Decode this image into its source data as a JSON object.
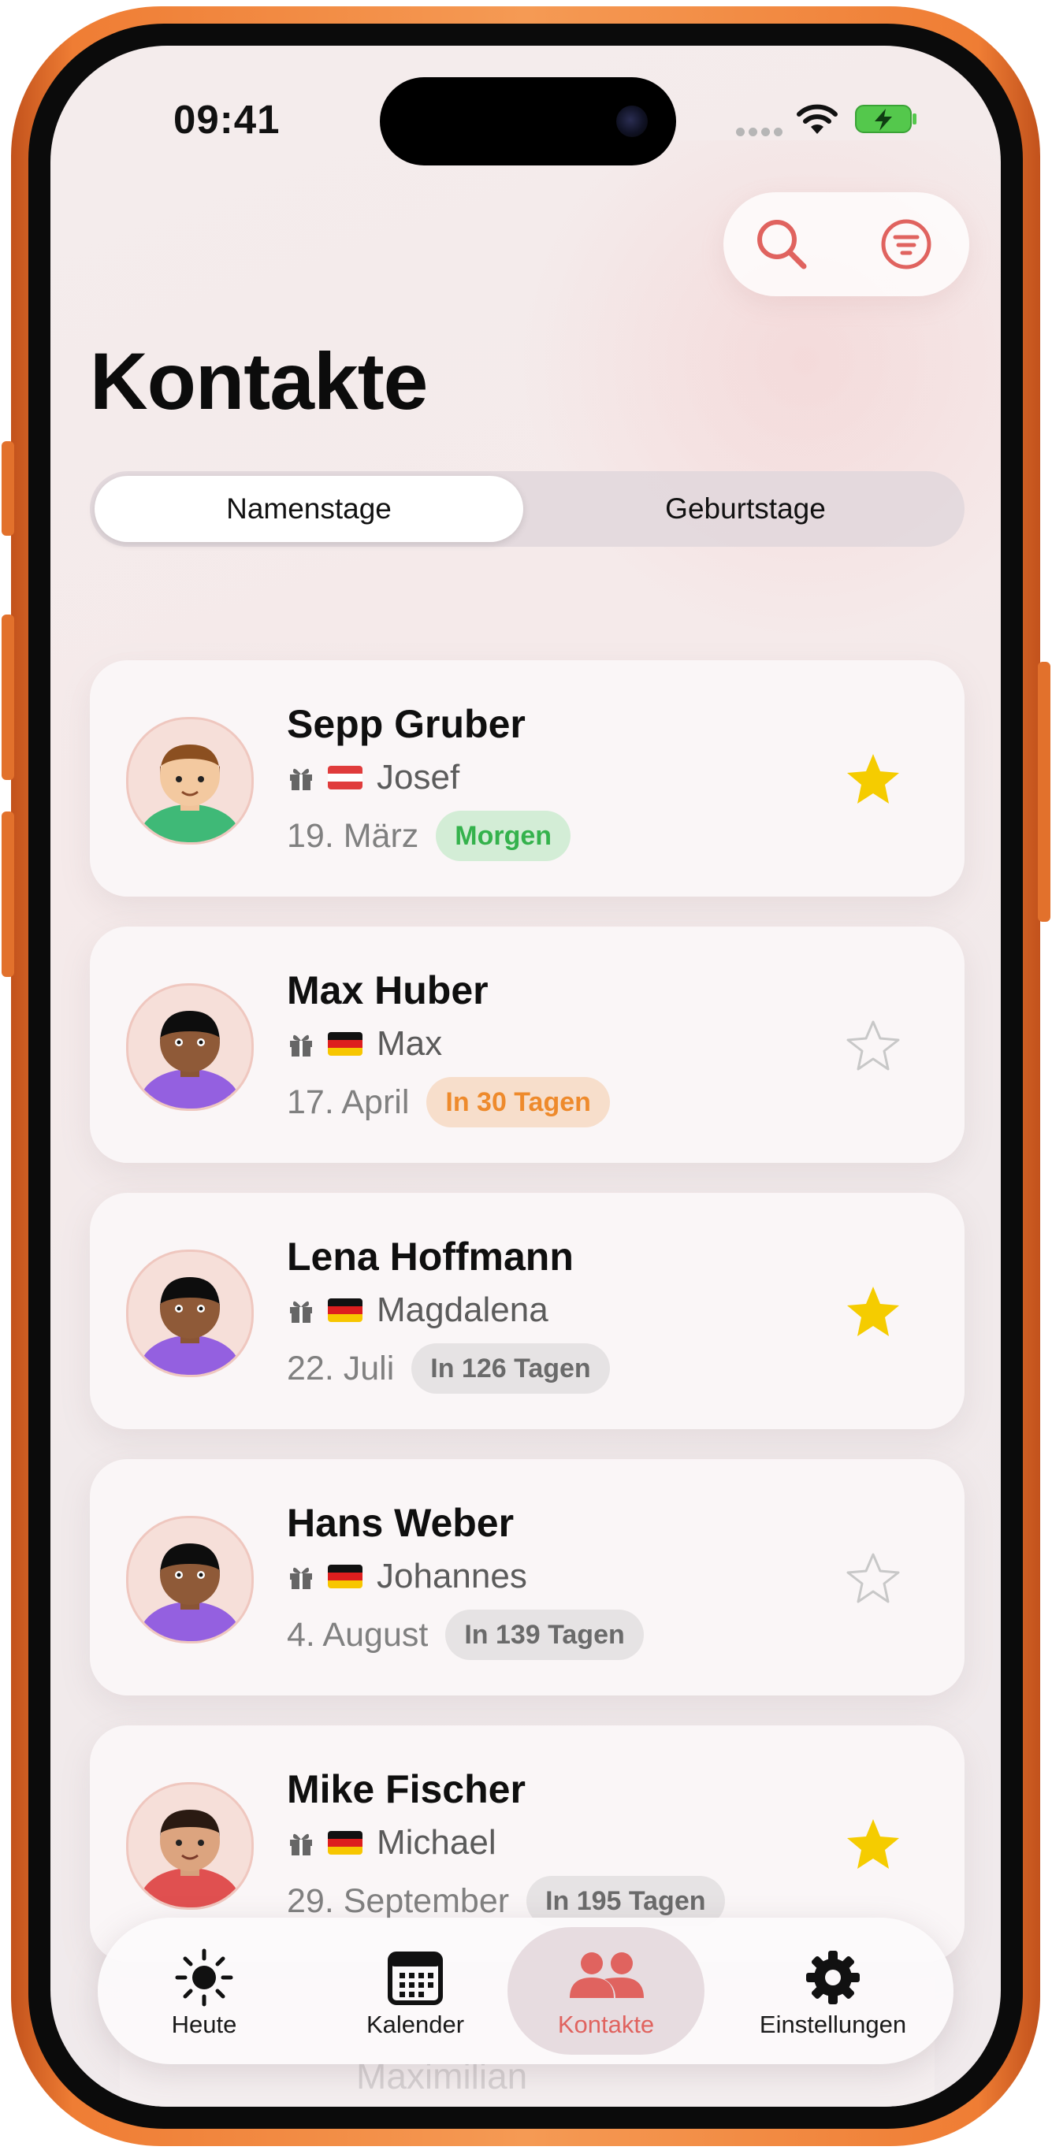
{
  "status_bar": {
    "time": "09:41"
  },
  "header": {
    "title": "Kontakte",
    "search_icon": "search-icon",
    "filter_icon": "filter-icon"
  },
  "segments": [
    {
      "label": "Namenstage",
      "selected": true
    },
    {
      "label": "Geburtstage",
      "selected": false
    }
  ],
  "contacts": [
    {
      "name": "Sepp Gruber",
      "flag": "austria",
      "nameday": "Josef",
      "date": "19. März",
      "badge": "Morgen",
      "badge_style": "green",
      "favorite": true,
      "avatar": "boy-brown-hair-green-shirt"
    },
    {
      "name": "Max Huber",
      "flag": "germany",
      "nameday": "Max",
      "date": "17. April",
      "badge": "In 30 Tagen",
      "badge_style": "orange",
      "favorite": false,
      "avatar": "person-purple-shirt"
    },
    {
      "name": "Lena Hoffmann",
      "flag": "germany",
      "nameday": "Magdalena",
      "date": "22. Juli",
      "badge": "In 126 Tagen",
      "badge_style": "gray",
      "favorite": true,
      "avatar": "person-purple-shirt"
    },
    {
      "name": "Hans Weber",
      "flag": "germany",
      "nameday": "Johannes",
      "date": "4. August",
      "badge": "In 139 Tagen",
      "badge_style": "gray",
      "favorite": false,
      "avatar": "person-purple-shirt"
    },
    {
      "name": "Mike Fischer",
      "flag": "germany",
      "nameday": "Michael",
      "date": "29. September",
      "badge": "In 195 Tagen",
      "badge_style": "gray",
      "favorite": true,
      "avatar": "person-red-shirt"
    }
  ],
  "partial_contact": {
    "nameday": "Maximilian"
  },
  "colors": {
    "accent": "#E0635F",
    "star_filled": "#F5CC00",
    "star_empty": "#C8C8C8",
    "badge_green_bg": "#D3EDD6",
    "badge_green_text": "#34B24C",
    "badge_orange_bg": "#F7DECB",
    "badge_orange_text": "#EE8A2C",
    "badge_gray_bg": "#E6E3E4",
    "badge_gray_text": "#6A6A6A",
    "frame": "#EF7D34"
  },
  "tabbar": [
    {
      "label": "Heute",
      "icon": "sun-icon",
      "selected": false
    },
    {
      "label": "Kalender",
      "icon": "calendar-icon",
      "selected": false
    },
    {
      "label": "Kontakte",
      "icon": "contacts-icon",
      "selected": true
    },
    {
      "label": "Einstellungen",
      "icon": "gear-icon",
      "selected": false
    }
  ]
}
